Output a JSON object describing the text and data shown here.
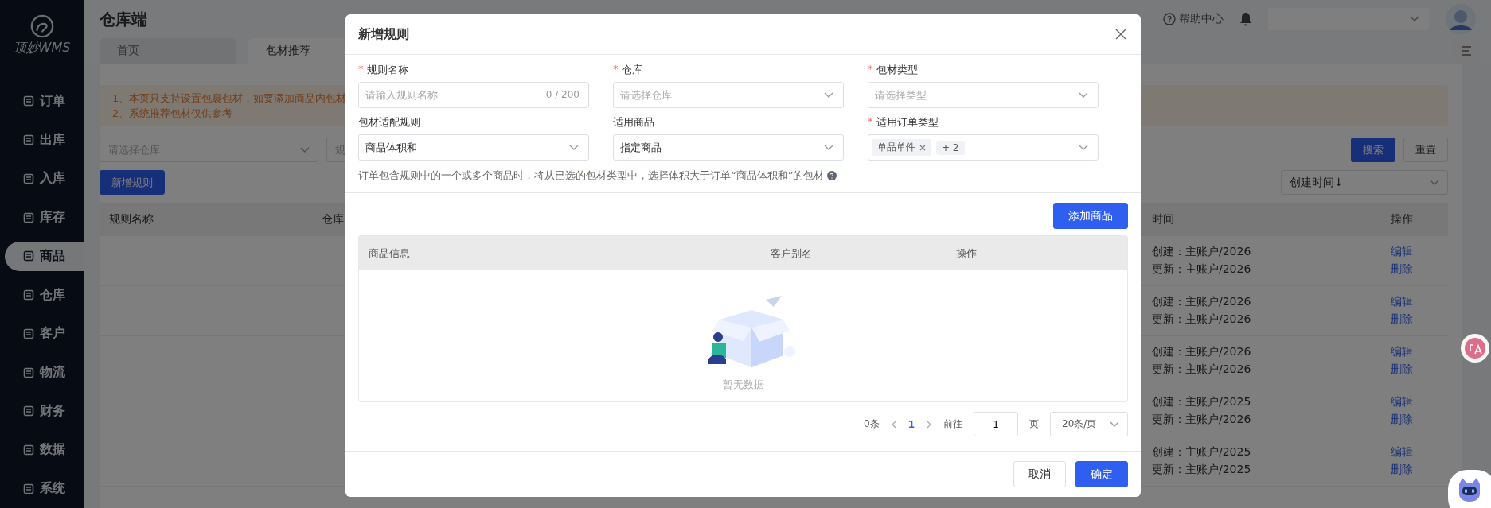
{
  "sidebar": {
    "logo": "顶妙WMS",
    "items": [
      {
        "label": "订单",
        "selected": false
      },
      {
        "label": "出库",
        "selected": false
      },
      {
        "label": "入库",
        "selected": false
      },
      {
        "label": "库存",
        "selected": false
      },
      {
        "label": "商品",
        "selected": true
      },
      {
        "label": "仓库",
        "selected": false
      },
      {
        "label": "客户",
        "selected": false
      },
      {
        "label": "物流",
        "selected": false
      },
      {
        "label": "财务",
        "selected": false
      },
      {
        "label": "数据",
        "selected": false
      },
      {
        "label": "系统",
        "selected": false
      }
    ]
  },
  "header": {
    "title": "仓库端",
    "help": "帮助中心"
  },
  "tabs": [
    {
      "label": "首页",
      "selected": false,
      "closable": false
    },
    {
      "label": "包材推荐",
      "selected": true,
      "closable": true
    }
  ],
  "notice": [
    "1、本页只支持设置包裹包材，如要添加商品内包材",
    "2、系统推荐包材仅供参考"
  ],
  "filters": [
    {
      "placeholder": "请选择仓库"
    },
    {
      "placeholder": "规"
    }
  ],
  "filter_buttons": {
    "search": "搜索",
    "reset": "重置"
  },
  "add_button": "新增规则",
  "sort": {
    "value": "创建时间↓"
  },
  "table": {
    "columns": [
      "规则名称",
      "仓库",
      "时间",
      "操作"
    ],
    "rows": [
      {
        "created": "创建：主账户/2026",
        "updated": "更新：主账户/2026",
        "actions": [
          "编辑",
          "删除"
        ]
      },
      {
        "created": "创建：主账户/2026",
        "updated": "更新：主账户/2026",
        "actions": [
          "编辑",
          "删除"
        ]
      },
      {
        "created": "创建：主账户/2026",
        "updated": "更新：主账户/2026",
        "actions": [
          "编辑",
          "删除"
        ]
      },
      {
        "created": "创建：主账户/2025",
        "updated": "更新：主账户/2026",
        "actions": [
          "编辑",
          "删除"
        ]
      },
      {
        "created": "创建：主账户/2025",
        "updated": "更新：主账户/2025",
        "actions": [
          "编辑",
          "删除"
        ]
      }
    ]
  },
  "dialog": {
    "title": "新增规则",
    "fields": [
      {
        "kind": "input",
        "required_mark": "*",
        "label": "规则名称",
        "placeholder": "请输入规则名称",
        "counter": "0 / 200"
      },
      {
        "kind": "select",
        "required_mark": "*",
        "label": "仓库",
        "placeholder": "请选择仓库"
      },
      {
        "kind": "select",
        "required_mark": "*",
        "label": "包材类型",
        "placeholder": "请选择类型"
      },
      {
        "kind": "select",
        "label": "包材适配规则",
        "value": "商品体积和"
      },
      {
        "kind": "select",
        "label": "适用商品",
        "value": "指定商品"
      },
      {
        "kind": "tags",
        "required_mark": "*",
        "label": "适用订单类型",
        "tags": [
          {
            "label": "单品单件",
            "closable": true
          },
          {
            "label": "+ 2",
            "closable": false
          }
        ]
      }
    ],
    "hint": "订单包含规则中的一个或多个商品时，将从已选的包材类型中，选择体积大于订单“商品体积和”的包材",
    "add_goods": "添加商品",
    "columns": [
      "商品信息",
      "客户别名",
      "操作"
    ],
    "empty": "暂无数据",
    "pagination": {
      "total": "0条",
      "pages": [
        {
          "label": "1",
          "selected": true
        }
      ],
      "goto": "前往",
      "page_value": "1",
      "page_unit": "页",
      "size": "20条/页"
    },
    "cancel": "取消",
    "confirm": "确定"
  }
}
